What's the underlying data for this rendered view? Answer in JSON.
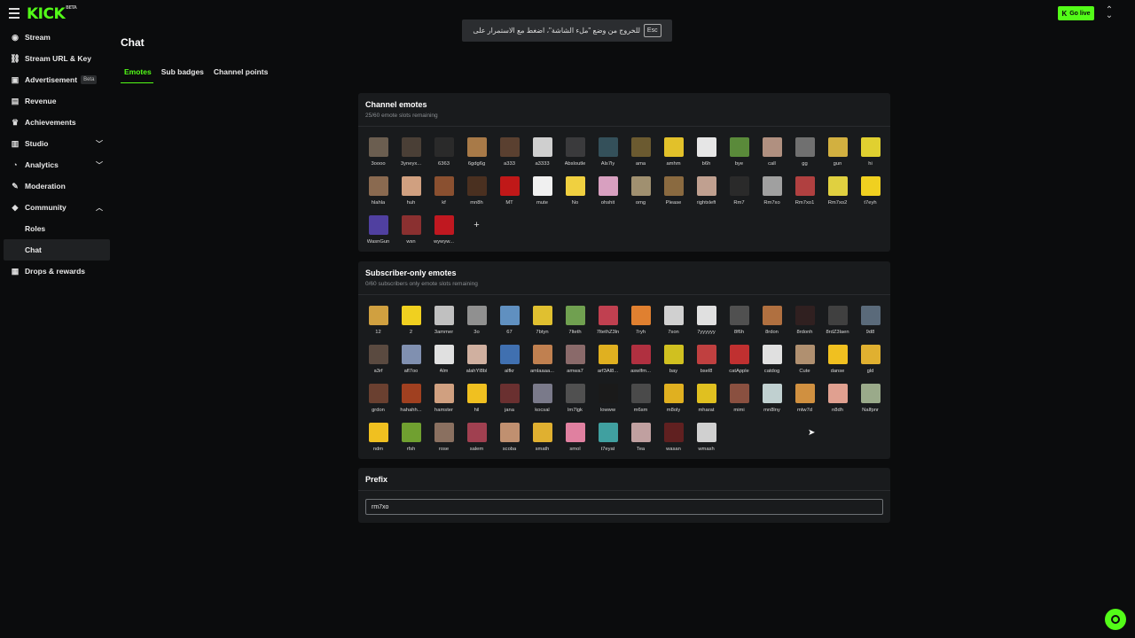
{
  "logo": {
    "text": "KICK",
    "badge": "BETA"
  },
  "fullscreen_notice": {
    "text": "للخروج من وضع \"ملء الشاشة\"، اضغط مع الاستمرار على",
    "key": "Esc"
  },
  "header": {
    "go_live_label": "Go live",
    "go_live_icon": "kick-k-icon"
  },
  "sidebar": {
    "items": [
      {
        "label": "Stream",
        "icon": "broadcast-icon"
      },
      {
        "label": "Stream URL & Key",
        "icon": "link-icon"
      },
      {
        "label": "Advertisement",
        "icon": "ad-icon",
        "badge": "Beta"
      },
      {
        "label": "Revenue",
        "icon": "revenue-icon"
      },
      {
        "label": "Achievements",
        "icon": "trophy-icon"
      },
      {
        "label": "Studio",
        "icon": "studio-icon",
        "expand": "down"
      },
      {
        "label": "Analytics",
        "icon": "analytics-icon",
        "expand": "down"
      },
      {
        "label": "Moderation",
        "icon": "wrench-icon"
      },
      {
        "label": "Community",
        "icon": "community-icon",
        "expand": "up"
      },
      {
        "label": "Roles",
        "sub": true
      },
      {
        "label": "Chat",
        "sub": true,
        "active": true
      },
      {
        "label": "Drops & rewards",
        "icon": "drops-icon"
      }
    ]
  },
  "page": {
    "title": "Chat",
    "tabs": [
      {
        "label": "Emotes",
        "active": true
      },
      {
        "label": "Sub badges"
      },
      {
        "label": "Channel points"
      }
    ]
  },
  "channel_emotes": {
    "title": "Channel emotes",
    "subtitle": "25/60 emote slots remaining",
    "add_label": "+",
    "emotes": [
      {
        "name": "3oooo",
        "color": "#6b5e50"
      },
      {
        "name": "3yneyx...",
        "color": "#4a3f36"
      },
      {
        "name": "6363",
        "color": "#2a2a2a"
      },
      {
        "name": "6gdg6g",
        "color": "#a87a48"
      },
      {
        "name": "a333",
        "color": "#5a4030"
      },
      {
        "name": "a3333",
        "color": "#cfcfcf"
      },
      {
        "name": "Absloutle",
        "color": "#3a3a3c"
      },
      {
        "name": "Als7ly",
        "color": "#34505a"
      },
      {
        "name": "ama",
        "color": "#6b5a30"
      },
      {
        "name": "amhm",
        "color": "#e2c12a"
      },
      {
        "name": "b6h",
        "color": "#e6e6e6"
      },
      {
        "name": "bye",
        "color": "#5a8a3a"
      },
      {
        "name": "call",
        "color": "#b09080"
      },
      {
        "name": "gg",
        "color": "#707070"
      },
      {
        "name": "gun",
        "color": "#d2b040"
      },
      {
        "name": "hi",
        "color": "#e0d030"
      },
      {
        "name": "hlahla",
        "color": "#8a6a50"
      },
      {
        "name": "huh",
        "color": "#d0a080"
      },
      {
        "name": "kf",
        "color": "#8a5030"
      },
      {
        "name": "mn8h",
        "color": "#4a3020"
      },
      {
        "name": "MT",
        "color": "#c01818"
      },
      {
        "name": "mute",
        "color": "#f0f0f0"
      },
      {
        "name": "No",
        "color": "#f0d040"
      },
      {
        "name": "ohshit",
        "color": "#d8a0c0"
      },
      {
        "name": "omg",
        "color": "#a09070"
      },
      {
        "name": "Please",
        "color": "#8a6a40"
      },
      {
        "name": "rightxleft",
        "color": "#c0a090"
      },
      {
        "name": "Rm7",
        "color": "#2a2a2a"
      },
      {
        "name": "Rm7xo",
        "color": "#a0a0a0"
      },
      {
        "name": "Rm7xo1",
        "color": "#b04040"
      },
      {
        "name": "Rm7xo2",
        "color": "#e0d040"
      },
      {
        "name": "t7eyh",
        "color": "#f0d020"
      },
      {
        "name": "WasnGun",
        "color": "#5040a0"
      },
      {
        "name": "wsn",
        "color": "#8a3030"
      },
      {
        "name": "wywyw...",
        "color": "#c01820"
      }
    ]
  },
  "subscriber_emotes": {
    "title": "Subscriber-only emotes",
    "subtitle": "0/60 subscribers only emote slots remaining",
    "emotes": [
      {
        "name": "12",
        "color": "#d0a040"
      },
      {
        "name": "2",
        "color": "#f0d020"
      },
      {
        "name": "3ammer",
        "color": "#c0c0c0"
      },
      {
        "name": "3o",
        "color": "#909090"
      },
      {
        "name": "67",
        "color": "#6090c0"
      },
      {
        "name": "7btyn",
        "color": "#e0c030"
      },
      {
        "name": "7lteth",
        "color": "#70a050"
      },
      {
        "name": "7ltethZ3ln",
        "color": "#c04050"
      },
      {
        "name": "7ryh",
        "color": "#e08030"
      },
      {
        "name": "7son",
        "color": "#d0d0d0"
      },
      {
        "name": "7yyyyyy",
        "color": "#e0e0e0"
      },
      {
        "name": "8f6h",
        "color": "#505050"
      },
      {
        "name": "8rdon",
        "color": "#b07040"
      },
      {
        "name": "8rdonh",
        "color": "#302020"
      },
      {
        "name": "8rdZ3laen",
        "color": "#404040"
      },
      {
        "name": "9d8",
        "color": "#5a6a7a"
      },
      {
        "name": "a3rf",
        "color": "#5a4a40"
      },
      {
        "name": "afl7oo",
        "color": "#8090b0"
      },
      {
        "name": "Alm",
        "color": "#e0e0e0"
      },
      {
        "name": "alahYl8bl",
        "color": "#d0b0a0"
      },
      {
        "name": "alfkr",
        "color": "#4070b0"
      },
      {
        "name": "amlaaaa...",
        "color": "#c08050"
      },
      {
        "name": "amwa7",
        "color": "#8a6a6a"
      },
      {
        "name": "arf3Al8...",
        "color": "#e0b020"
      },
      {
        "name": "aswlfm...",
        "color": "#b03040"
      },
      {
        "name": "bay",
        "color": "#d0c020"
      },
      {
        "name": "bsel8",
        "color": "#c04040"
      },
      {
        "name": "catApple",
        "color": "#c03030"
      },
      {
        "name": "catdog",
        "color": "#e0e0e0"
      },
      {
        "name": "Cute",
        "color": "#b09070"
      },
      {
        "name": "danse",
        "color": "#f0c020"
      },
      {
        "name": "gld",
        "color": "#e0b030"
      },
      {
        "name": "grdon",
        "color": "#6a4030"
      },
      {
        "name": "hahahh...",
        "color": "#a04020"
      },
      {
        "name": "hamster",
        "color": "#d0a080"
      },
      {
        "name": "hil",
        "color": "#f0c020"
      },
      {
        "name": "jana",
        "color": "#6a3030"
      },
      {
        "name": "kocsal",
        "color": "#7a7a8a"
      },
      {
        "name": "lm7lgk",
        "color": "#505050"
      },
      {
        "name": "lowww",
        "color": "#1a1a1a"
      },
      {
        "name": "m6sm",
        "color": "#4a4a4a"
      },
      {
        "name": "m8oly",
        "color": "#e0b020"
      },
      {
        "name": "mharat",
        "color": "#e0c020"
      },
      {
        "name": "mimi",
        "color": "#8a5040"
      },
      {
        "name": "mn8lny",
        "color": "#c0d0d0"
      },
      {
        "name": "mtw7d",
        "color": "#d09040"
      },
      {
        "name": "n8dh",
        "color": "#e0a090"
      },
      {
        "name": "Nalfpnr",
        "color": "#9aaa8a"
      },
      {
        "name": "ndm",
        "color": "#f0c020"
      },
      {
        "name": "rfsh",
        "color": "#70a030"
      },
      {
        "name": "rose",
        "color": "#8a7060"
      },
      {
        "name": "salem",
        "color": "#a04050"
      },
      {
        "name": "scoba",
        "color": "#c09070"
      },
      {
        "name": "smath",
        "color": "#e0b030"
      },
      {
        "name": "smol",
        "color": "#e080a0"
      },
      {
        "name": "t7eyat",
        "color": "#40a0a0"
      },
      {
        "name": "Tea",
        "color": "#c0a0a0"
      },
      {
        "name": "wasan",
        "color": "#602020"
      },
      {
        "name": "wmash",
        "color": "#d0d0d0"
      }
    ]
  },
  "prefix": {
    "title": "Prefix",
    "value": "rm7xo"
  }
}
